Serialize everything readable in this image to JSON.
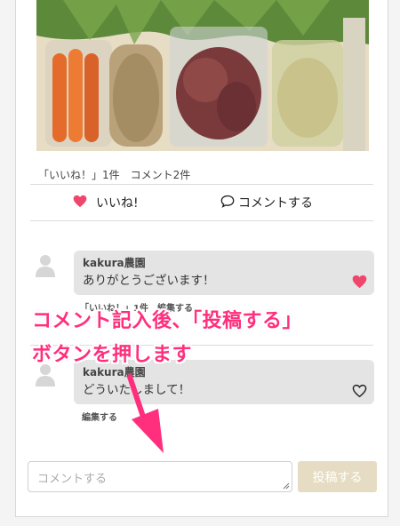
{
  "post": {
    "counts": "「いいね！」1件　コメント2件",
    "like_label": "いいね!",
    "comment_label": "コメントする"
  },
  "comments": [
    {
      "author": "kakura農園",
      "text": "ありがとうございます！",
      "liked": true,
      "edit_label": "「いいね！」1件　編集する"
    },
    {
      "author": "kakura農園",
      "text": "どういたしまして！",
      "liked": false,
      "edit_label": "編集する"
    }
  ],
  "composer": {
    "placeholder": "コメントする",
    "submit_label": "投稿する"
  },
  "annotation": {
    "line1": "コメント記入後、「投稿する」",
    "line2": "ボタンを押します"
  },
  "colors": {
    "accent_pink": "#ff2f7d",
    "heart_red": "#f0466b",
    "submit_disabled": "#e6dcc3"
  },
  "icons": {
    "like": "heart-icon",
    "comment": "speech-bubble-icon",
    "avatar": "user-silhouette-icon"
  }
}
